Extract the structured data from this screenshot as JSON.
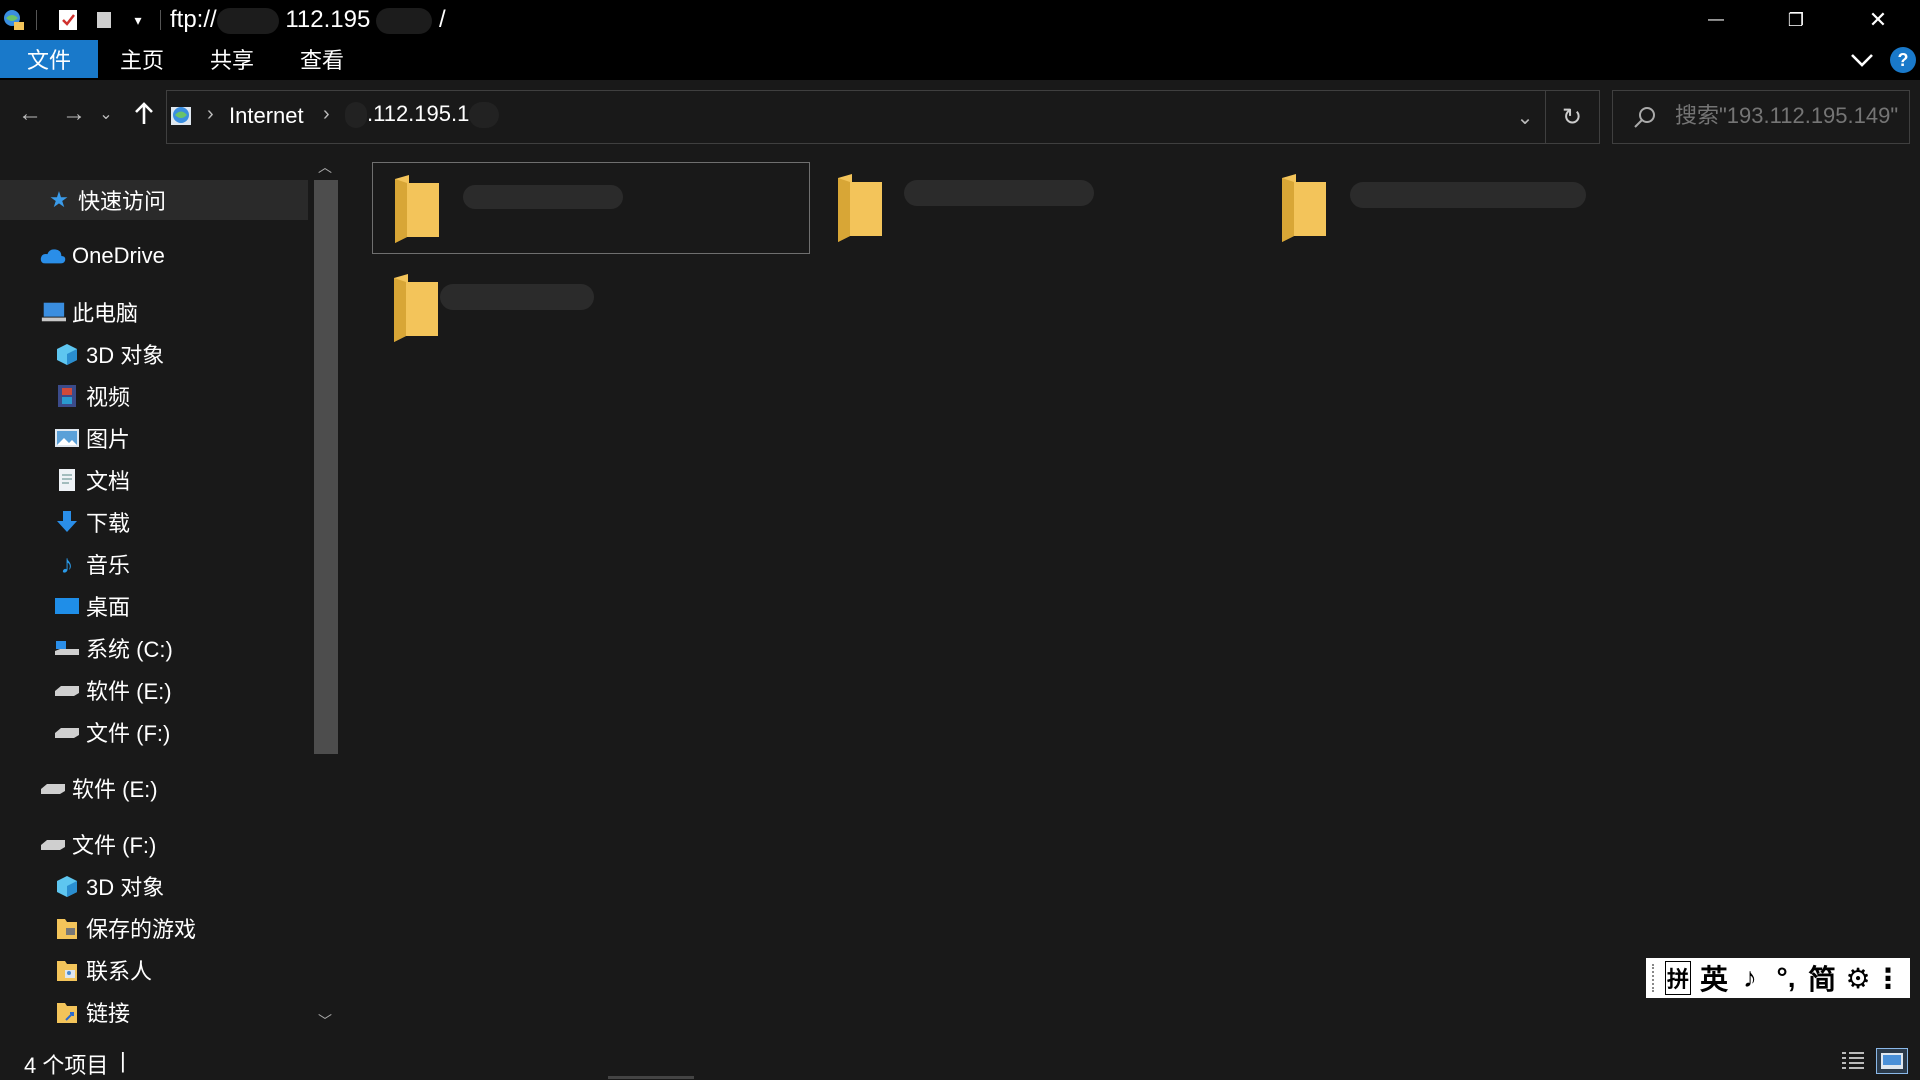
{
  "window": {
    "title_prefix": "ftp://",
    "title_middle": "112.195",
    "title_suffix": "/",
    "controls": {
      "minimize": "—",
      "restore": "❐",
      "close": "✕"
    }
  },
  "ribbon": {
    "tabs": [
      {
        "label": "文件",
        "active": true
      },
      {
        "label": "主页"
      },
      {
        "label": "共享"
      },
      {
        "label": "查看"
      }
    ],
    "help": "?"
  },
  "address": {
    "crumbs": [
      "Internet",
      ".112.195.1"
    ],
    "separator": "›",
    "refresh": "↻",
    "dropdown": "⌄"
  },
  "search": {
    "placeholder": "搜索\"193.112.195.149\""
  },
  "sidebar": {
    "quick_access": "快速访问",
    "onedrive": "OneDrive",
    "this_pc": "此电脑",
    "pc_items": [
      {
        "label": "3D 对象",
        "icon": "cube-icon"
      },
      {
        "label": "视频",
        "icon": "video-icon"
      },
      {
        "label": "图片",
        "icon": "pictures-icon"
      },
      {
        "label": "文档",
        "icon": "documents-icon"
      },
      {
        "label": "下载",
        "icon": "download-icon"
      },
      {
        "label": "音乐",
        "icon": "music-icon"
      },
      {
        "label": "桌面",
        "icon": "desktop-icon"
      },
      {
        "label": "系统 (C:)",
        "icon": "system-drive-icon"
      },
      {
        "label": "软件 (E:)",
        "icon": "drive-icon"
      },
      {
        "label": "文件 (F:)",
        "icon": "drive-icon"
      }
    ],
    "drive_e": "软件 (E:)",
    "drive_f": "文件 (F:)",
    "f_items": [
      {
        "label": "3D 对象"
      },
      {
        "label": "保存的游戏"
      },
      {
        "label": "联系人"
      },
      {
        "label": "链接"
      }
    ]
  },
  "status": {
    "count": "4 个项目",
    "separator": "|"
  },
  "ime": {
    "buttons": [
      "拼",
      "英",
      "♪",
      "°,",
      "简",
      "⚙",
      "⋮"
    ]
  },
  "colors": {
    "accent": "#1979ca",
    "folder": "#f3c45a",
    "folder_dark": "#d8a636",
    "background": "#191919"
  }
}
